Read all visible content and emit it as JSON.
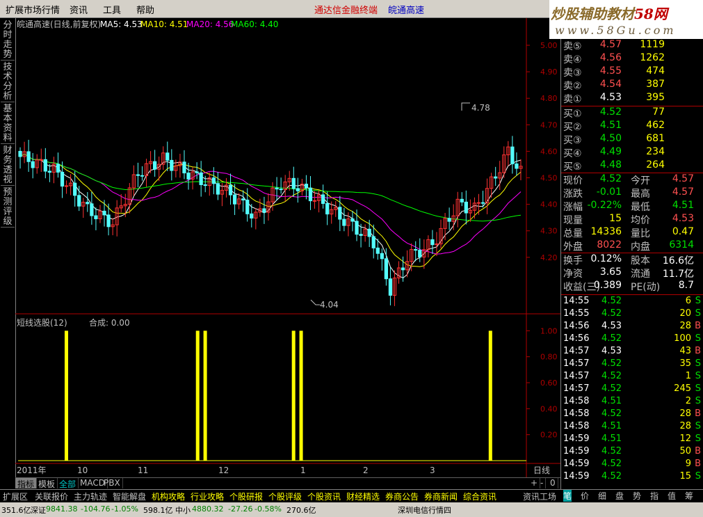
{
  "menubar": {
    "items": [
      "扩展市场行情",
      "资讯",
      "工具",
      "帮助"
    ],
    "promo_left": "通达信金融终端",
    "promo_right": "皖通高速"
  },
  "brand": {
    "line1a": "炒股辅助教材",
    "line1b": "58网",
    "line2": "www.58Gu.com"
  },
  "left_tabs": [
    "分时走势",
    "技术分析",
    "基本资料",
    "财务透视",
    "预测评级"
  ],
  "chart_header": {
    "stock": "皖通高速(日线,前复权)",
    "ma5_label": "MA5: 4.53",
    "ma10_label": "MA10: 4.51",
    "ma20_label": "MA20: 4.56",
    "ma60_label": "MA60: 4.40",
    "ma5_color": "#ffffff",
    "ma10_color": "#ffff00",
    "ma20_color": "#ff00ff",
    "ma60_color": "#00ff00"
  },
  "price_axis": [
    "5.00",
    "4.90",
    "4.80",
    "4.70",
    "4.60",
    "4.50",
    "4.40",
    "4.30",
    "4.20"
  ],
  "price_annotations": {
    "high": "4.78",
    "low": "4.04"
  },
  "indicator": {
    "title": "短线选股(12)",
    "value_label": "合成: 0.00",
    "axis": [
      "1.00",
      "0.80",
      "0.60",
      "0.40",
      "0.20"
    ]
  },
  "date_axis": {
    "year": "2011年",
    "months": [
      "10",
      "11",
      "12",
      "1",
      "2",
      "3"
    ],
    "period": "日线"
  },
  "chart_data": {
    "type": "candlestick",
    "title": "皖通高速(日线,前复权)",
    "ylim": [
      4.0,
      5.05
    ],
    "markers": {
      "high": 4.78,
      "low": 4.04
    },
    "ma_latest": {
      "MA5": 4.53,
      "MA10": 4.51,
      "MA20": 4.56,
      "MA60": 4.4
    },
    "indicator_series": {
      "name": "短线选股(12)",
      "ylim": [
        0,
        1.05
      ],
      "signal_value": 1.0,
      "signal_positions": [
        0.095,
        0.355,
        0.37,
        0.545,
        0.56,
        0.935
      ]
    }
  },
  "quote": {
    "asks": [
      {
        "label": "卖⑤",
        "price": "4.57",
        "vol": "1119"
      },
      {
        "label": "卖④",
        "price": "4.56",
        "vol": "1262"
      },
      {
        "label": "卖③",
        "price": "4.55",
        "vol": "474"
      },
      {
        "label": "卖②",
        "price": "4.54",
        "vol": "387"
      },
      {
        "label": "卖①",
        "price": "4.53",
        "vol": "395"
      }
    ],
    "bids": [
      {
        "label": "买①",
        "price": "4.52",
        "vol": "77"
      },
      {
        "label": "买②",
        "price": "4.51",
        "vol": "462"
      },
      {
        "label": "买③",
        "price": "4.50",
        "vol": "681"
      },
      {
        "label": "买④",
        "price": "4.49",
        "vol": "234"
      },
      {
        "label": "买⑤",
        "price": "4.48",
        "vol": "264"
      }
    ],
    "stats": [
      {
        "l1": "现价",
        "v1": "4.52",
        "c1": "green",
        "l2": "今开",
        "v2": "4.57",
        "c2": "red"
      },
      {
        "l1": "涨跌",
        "v1": "-0.01",
        "c1": "green",
        "l2": "最高",
        "v2": "4.57",
        "c2": "red"
      },
      {
        "l1": "涨幅",
        "v1": "-0.22%",
        "c1": "green",
        "l2": "最低",
        "v2": "4.51",
        "c2": "green"
      },
      {
        "l1": "现量",
        "v1": "15",
        "c1": "yellow",
        "l2": "均价",
        "v2": "4.53",
        "c2": "red"
      },
      {
        "l1": "总量",
        "v1": "14336",
        "c1": "yellow",
        "l2": "量比",
        "v2": "0.47",
        "c2": "yellow"
      },
      {
        "l1": "外盘",
        "v1": "8022",
        "c1": "red",
        "l2": "内盘",
        "v2": "6314",
        "c2": "green"
      }
    ],
    "stats2": [
      {
        "l1": "换手",
        "v1": "0.12%",
        "l2": "股本",
        "v2": "16.6亿"
      },
      {
        "l1": "净资",
        "v1": "3.65",
        "l2": "流通",
        "v2": "11.7亿"
      },
      {
        "l1": "收益(三)",
        "v1": "0.389",
        "l2": "PE(动)",
        "v2": "8.7"
      }
    ],
    "ticks": [
      {
        "t": "14:55",
        "p": "4.52",
        "pc": "green",
        "v": "6",
        "s": "S"
      },
      {
        "t": "14:55",
        "p": "4.52",
        "pc": "green",
        "v": "20",
        "s": "S"
      },
      {
        "t": "14:56",
        "p": "4.53",
        "pc": "white",
        "v": "28",
        "s": "B"
      },
      {
        "t": "14:56",
        "p": "4.52",
        "pc": "green",
        "v": "100",
        "s": "S"
      },
      {
        "t": "14:57",
        "p": "4.53",
        "pc": "white",
        "v": "43",
        "s": "B"
      },
      {
        "t": "14:57",
        "p": "4.52",
        "pc": "green",
        "v": "35",
        "s": "S"
      },
      {
        "t": "14:57",
        "p": "4.52",
        "pc": "green",
        "v": "1",
        "s": "S"
      },
      {
        "t": "14:57",
        "p": "4.52",
        "pc": "green",
        "v": "245",
        "s": "S"
      },
      {
        "t": "14:58",
        "p": "4.51",
        "pc": "green",
        "v": "2",
        "s": "S"
      },
      {
        "t": "14:58",
        "p": "4.52",
        "pc": "green",
        "v": "28",
        "s": "B"
      },
      {
        "t": "14:58",
        "p": "4.51",
        "pc": "green",
        "v": "28",
        "s": "S"
      },
      {
        "t": "14:59",
        "p": "4.51",
        "pc": "green",
        "v": "12",
        "s": "S"
      },
      {
        "t": "14:59",
        "p": "4.52",
        "pc": "green",
        "v": "50",
        "s": "B"
      },
      {
        "t": "14:59",
        "p": "4.52",
        "pc": "green",
        "v": "9",
        "s": "B"
      },
      {
        "t": "14:59",
        "p": "4.52",
        "pc": "green",
        "v": "15",
        "s": "S"
      }
    ]
  },
  "bottom_tabs": [
    "指标",
    "模板",
    "全部",
    "MACD",
    "PBX"
  ],
  "info_tabs": [
    "扩展区",
    "关联报价",
    "主力轨迹",
    "智能解盘",
    "机构攻略",
    "行业攻略",
    "个股研报",
    "个股评级",
    "个股资讯",
    "财经精选",
    "券商公告",
    "券商新闻",
    "综合资讯",
    "资讯工场"
  ],
  "right_tabs": [
    "笔",
    "价",
    "细",
    "盘",
    "势",
    "指",
    "值",
    "筹"
  ],
  "zoom_controls": [
    "+",
    "-",
    "0"
  ],
  "status": {
    "sh": "351.6亿",
    "sz_label": "深证",
    "sz_value": "9841.38",
    "sz_chg": "-104.76",
    "sz_pct": "-1.05%",
    "sz_amt": "598.1亿",
    "zx_label": "中小",
    "zx_value": "4880.32",
    "zx_chg": "-27.26",
    "zx_pct": "-0.58%",
    "zx_amt": "270.6亿",
    "server": "深圳电信行情四"
  }
}
